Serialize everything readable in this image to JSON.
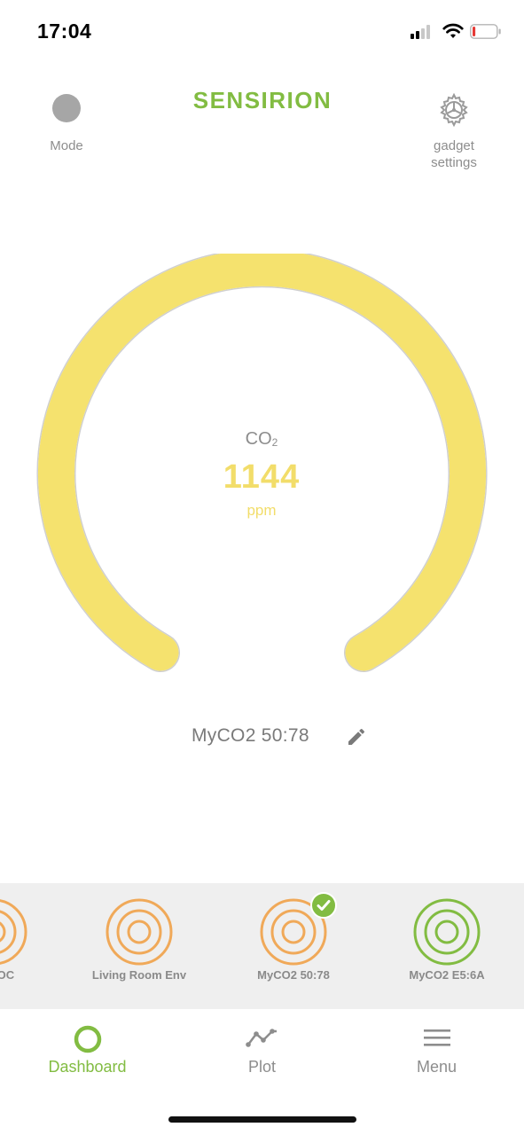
{
  "status_bar": {
    "time": "17:04",
    "battery_level_percent": 12,
    "battery_color": "#e53935"
  },
  "header": {
    "mode_label": "Mode",
    "brand": "SENSIRION",
    "brand_color": "#82bc42",
    "settings_label_line1": "gadget",
    "settings_label_line2": "settings",
    "settings_icon": "gear-icon"
  },
  "gauge": {
    "title": "CO",
    "title_subscript": "2",
    "value": "1144",
    "unit": "ppm",
    "fill_color": "#f5e26e",
    "level_fraction": 1.0
  },
  "device": {
    "name": "MyCO2 50:78",
    "edit_icon": "pencil-icon"
  },
  "devices": [
    {
      "label": "ce VOC",
      "ring_color": "#f0a959",
      "selected": false
    },
    {
      "label": "Living Room Env",
      "ring_color": "#f0a959",
      "selected": false
    },
    {
      "label": "MyCO2 50:78",
      "ring_color": "#f0a959",
      "selected": true
    },
    {
      "label": "MyCO2 E5:6A",
      "ring_color": "#82bc42",
      "selected": false
    }
  ],
  "tabs": [
    {
      "label": "Dashboard",
      "icon": "circle-icon",
      "active": true
    },
    {
      "label": "Plot",
      "icon": "line-chart-icon",
      "active": false
    },
    {
      "label": "Menu",
      "icon": "hamburger-icon",
      "active": false
    }
  ],
  "colors": {
    "active_green": "#82bc42",
    "inactive_gray": "#8d8d8d",
    "warning_yellow": "#f2dd6a"
  }
}
